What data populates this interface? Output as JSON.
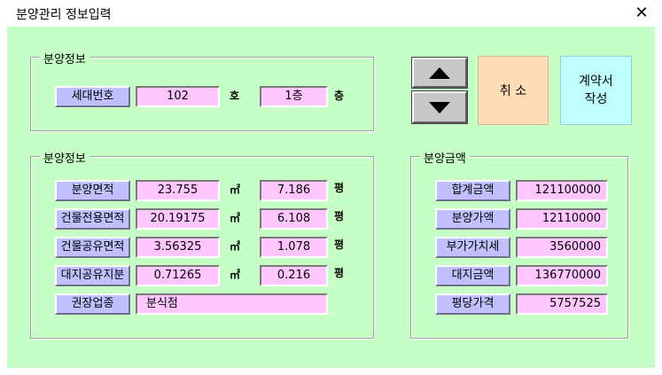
{
  "window": {
    "title": "분양관리 정보입력",
    "close_glyph": "✕"
  },
  "group1": {
    "title": "분양정보",
    "unit_label": "세대번호",
    "unit_no": "102",
    "ho_suffix": "호",
    "floor": "1층",
    "floor_suffix": "층"
  },
  "buttons": {
    "up_icon": "arrow-up",
    "down_icon": "arrow-down",
    "cancel": "취 소",
    "contract_line1": "계약서",
    "contract_line2": "작성"
  },
  "group2": {
    "title": "분양정보",
    "sqm_unit": "㎡",
    "pyeong_unit": "평",
    "rows": [
      {
        "label": "분양면적",
        "sqm": "23.755",
        "pyeong": "7.186"
      },
      {
        "label": "건물전용면적",
        "sqm": "20.19175",
        "pyeong": "6.108"
      },
      {
        "label": "건물공유면적",
        "sqm": "3.56325",
        "pyeong": "1.078"
      },
      {
        "label": "대지공유지분",
        "sqm": "0.71265",
        "pyeong": "0.216"
      }
    ],
    "business_label": "권장업종",
    "business_value": "분식점"
  },
  "group3": {
    "title": "분양금액",
    "rows": [
      {
        "label": "합계금액",
        "value": "121100000"
      },
      {
        "label": "분양가액",
        "value": "12110000"
      },
      {
        "label": "부가가치세",
        "value": "3560000"
      },
      {
        "label": "대지금액",
        "value": "136770000"
      },
      {
        "label": "평당가격",
        "value": "5757525"
      }
    ]
  }
}
